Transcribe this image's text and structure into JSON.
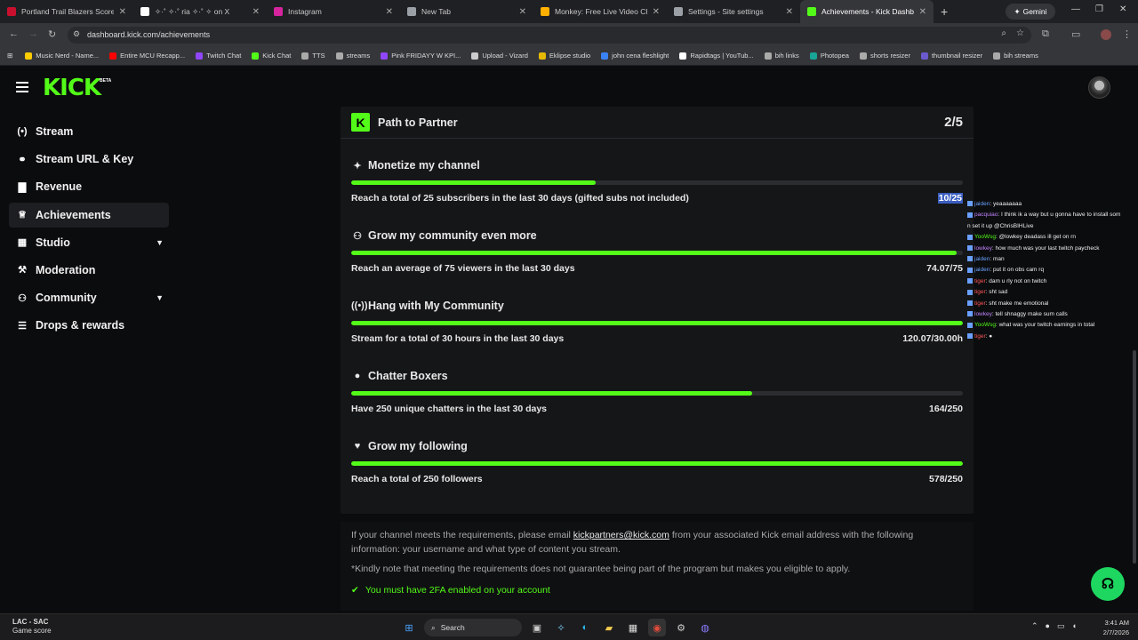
{
  "browser": {
    "tabs": [
      {
        "title": "Portland Trail Blazers Scores, St",
        "color": "#c8102e"
      },
      {
        "title": "✧·˚ ✧·˚ ria ✧·˚ ✧ on X",
        "color": "#ffffff"
      },
      {
        "title": "Instagram",
        "color": "#d6249f"
      },
      {
        "title": "New Tab",
        "color": "#9aa0a6"
      },
      {
        "title": "Monkey: Free Live Video Ch",
        "color": "#ffb000"
      },
      {
        "title": "Settings - Site settings",
        "color": "#9aa0a6"
      },
      {
        "title": "Achievements - Kick Dashboard",
        "color": "#53fc18"
      }
    ],
    "gemini_label": "Gemini",
    "url": "dashboard.kick.com/achievements",
    "bookmarks": [
      {
        "label": "Music Nerd - Name...",
        "color": "#ffcc00"
      },
      {
        "label": "Entire MCU Recapp...",
        "color": "#ff0000"
      },
      {
        "label": "Twitch Chat",
        "color": "#9146ff"
      },
      {
        "label": "Kick Chat",
        "color": "#53fc18"
      },
      {
        "label": "TTS",
        "color": "#aaaaaa"
      },
      {
        "label": "streams",
        "color": "#aaaaaa"
      },
      {
        "label": "Pink FRIDAYY W KPI...",
        "color": "#9146ff"
      },
      {
        "label": "Upload - Vizard",
        "color": "#cccccc"
      },
      {
        "label": "Eklipse studio",
        "color": "#e6b800"
      },
      {
        "label": "john cena fleshlight",
        "color": "#3b82f6"
      },
      {
        "label": "Rapidtags | YouTub...",
        "color": "#ffffff"
      },
      {
        "label": "bih links",
        "color": "#aaaaaa"
      },
      {
        "label": "Photopea",
        "color": "#18a497"
      },
      {
        "label": "shorts resizer",
        "color": "#aaaaaa"
      },
      {
        "label": "thumbnail resizer",
        "color": "#6a5acd"
      },
      {
        "label": "bih streams",
        "color": "#aaaaaa"
      }
    ]
  },
  "kick": {
    "logo": "KICK",
    "beta": "BETA",
    "sidebar": [
      {
        "label": "Stream",
        "icon": "(•)"
      },
      {
        "label": "Stream URL & Key",
        "icon": "⚭"
      },
      {
        "label": "Revenue",
        "icon": "▇"
      },
      {
        "label": "Achievements",
        "icon": "♕"
      },
      {
        "label": "Studio",
        "icon": "▦"
      },
      {
        "label": "Moderation",
        "icon": "⚒"
      },
      {
        "label": "Community",
        "icon": "⚇"
      },
      {
        "label": "Drops & rewards",
        "icon": "☰"
      }
    ],
    "card": {
      "title": "Path to Partner",
      "count": "2/5",
      "goals": [
        {
          "title": "Monetize my channel",
          "icon": "✦",
          "progress": 0.4,
          "requirement": "Reach a total of 25 subscribers in the last 30 days (gifted subs not included)",
          "value": "10/25"
        },
        {
          "title": "Grow my community even more",
          "icon": "⚇",
          "progress": 0.99,
          "requirement": "Reach an average of 75 viewers in the last 30 days",
          "value": "74.07/75"
        },
        {
          "title": "Hang with My Community",
          "icon": "((•))",
          "progress": 1.0,
          "requirement": "Stream for a total of 30 hours in the last 30 days",
          "value": "120.07/30.00h"
        },
        {
          "title": "Chatter Boxers",
          "icon": "●",
          "progress": 0.656,
          "requirement": "Have 250 unique chatters in the last 30 days",
          "value": "164/250"
        },
        {
          "title": "Grow my following",
          "icon": "♥",
          "progress": 1.0,
          "requirement": "Reach a total of 250 followers",
          "value": "578/250"
        }
      ]
    },
    "footer": {
      "text_before": "If your channel meets the requirements, please email ",
      "email": "kickpartners@kick.com",
      "text_after": " from your associated Kick email address with the following information: your username and what type of content you stream.",
      "note": "*Kindly note that meeting the requirements does not guarantee being part of the program but makes you eligible to apply.",
      "twofa": "You must have 2FA enabled on your account"
    }
  },
  "chat_overlay": [
    {
      "user": "jaiden",
      "msg": ": yeaaaaaaa",
      "color": "#6aa0ff"
    },
    {
      "user": "pacquiao",
      "msg": ": I think ik a way but u gonna have to install som",
      "color": "#c084fc"
    },
    {
      "user": "",
      "msg": "n set it up @ChrisBIHLive",
      "color": "#eeeeee"
    },
    {
      "user": "YooWsg",
      "msg": ": @lowkey deadass ill get on rn",
      "color": "#53fc18"
    },
    {
      "user": "lowkey",
      "msg": ": how much was your last twitch paycheck",
      "color": "#c084fc"
    },
    {
      "user": "jaiden",
      "msg": ": man",
      "color": "#6aa0ff"
    },
    {
      "user": "jaiden",
      "msg": ": put it on obs cam rq",
      "color": "#6aa0ff"
    },
    {
      "user": "tiger",
      "msg": ": dam u rly not on twitch",
      "color": "#ff5555"
    },
    {
      "user": "tiger",
      "msg": ": sht sad",
      "color": "#ff5555"
    },
    {
      "user": "tiger",
      "msg": ": sht make me emotional",
      "color": "#ff5555"
    },
    {
      "user": "lowkey",
      "msg": ": tell shnaggy make sum calls",
      "color": "#c084fc"
    },
    {
      "user": "YooWsg",
      "msg": ": what was your twitch earnings in total",
      "color": "#53fc18"
    },
    {
      "user": "tiger",
      "msg": ": ●",
      "color": "#ff5555"
    }
  ],
  "taskbar": {
    "weather_line1": "LAC - SAC",
    "weather_line2": "Game score",
    "search_label": "Search",
    "time": "3:41 AM",
    "date": "2/7/2026"
  }
}
